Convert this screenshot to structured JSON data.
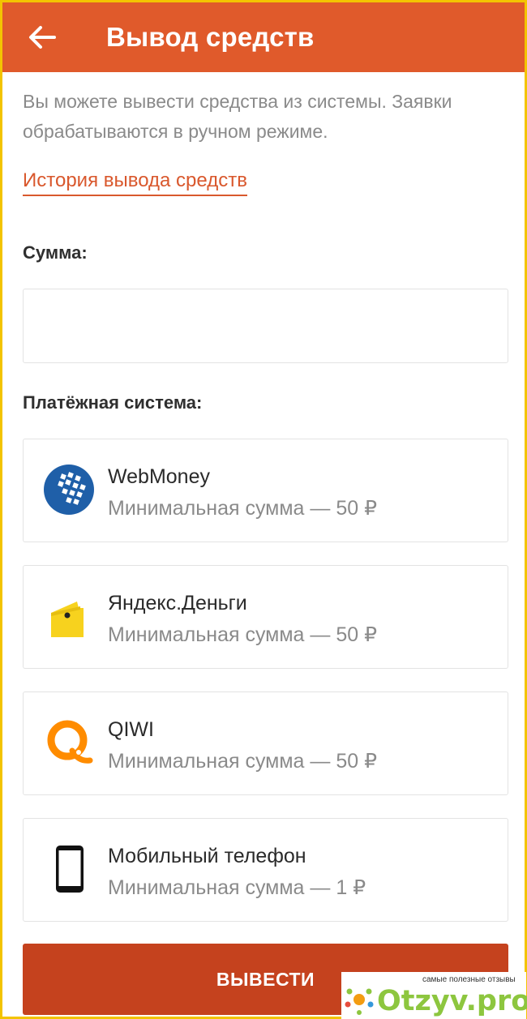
{
  "appbar": {
    "title": "Вывод средств",
    "back_icon": "arrow-left-icon"
  },
  "intro": {
    "text": "Вы можете вывести средства из системы. Заявки обрабатываются в ручном режиме."
  },
  "history_link": "История вывода средств",
  "amount": {
    "label": "Сумма:",
    "value": "",
    "placeholder": ""
  },
  "payment": {
    "label": "Платёжная система:",
    "methods": [
      {
        "name": "WebMoney",
        "min": "Минимальная сумма — 50 ₽",
        "icon": "webmoney-icon"
      },
      {
        "name": "Яндекс.Деньги",
        "min": "Минимальная сумма — 50 ₽",
        "icon": "yandex-money-icon"
      },
      {
        "name": "QIWI",
        "min": "Минимальная сумма — 50 ₽",
        "icon": "qiwi-icon"
      },
      {
        "name": "Мобильный телефон",
        "min": "Минимальная сумма — 1 ₽",
        "icon": "mobile-phone-icon"
      }
    ]
  },
  "submit_label": "ВЫВЕСТИ",
  "watermark": {
    "tagline": "самые полезные отзывы",
    "logo": "Otzyv.pro"
  },
  "colors": {
    "accent": "#e05a2b",
    "button": "#c5421e",
    "link": "#d9582d",
    "webmoney": "#1f5fa8",
    "yandex": "#f7d21e",
    "qiwi": "#ff8c00"
  }
}
